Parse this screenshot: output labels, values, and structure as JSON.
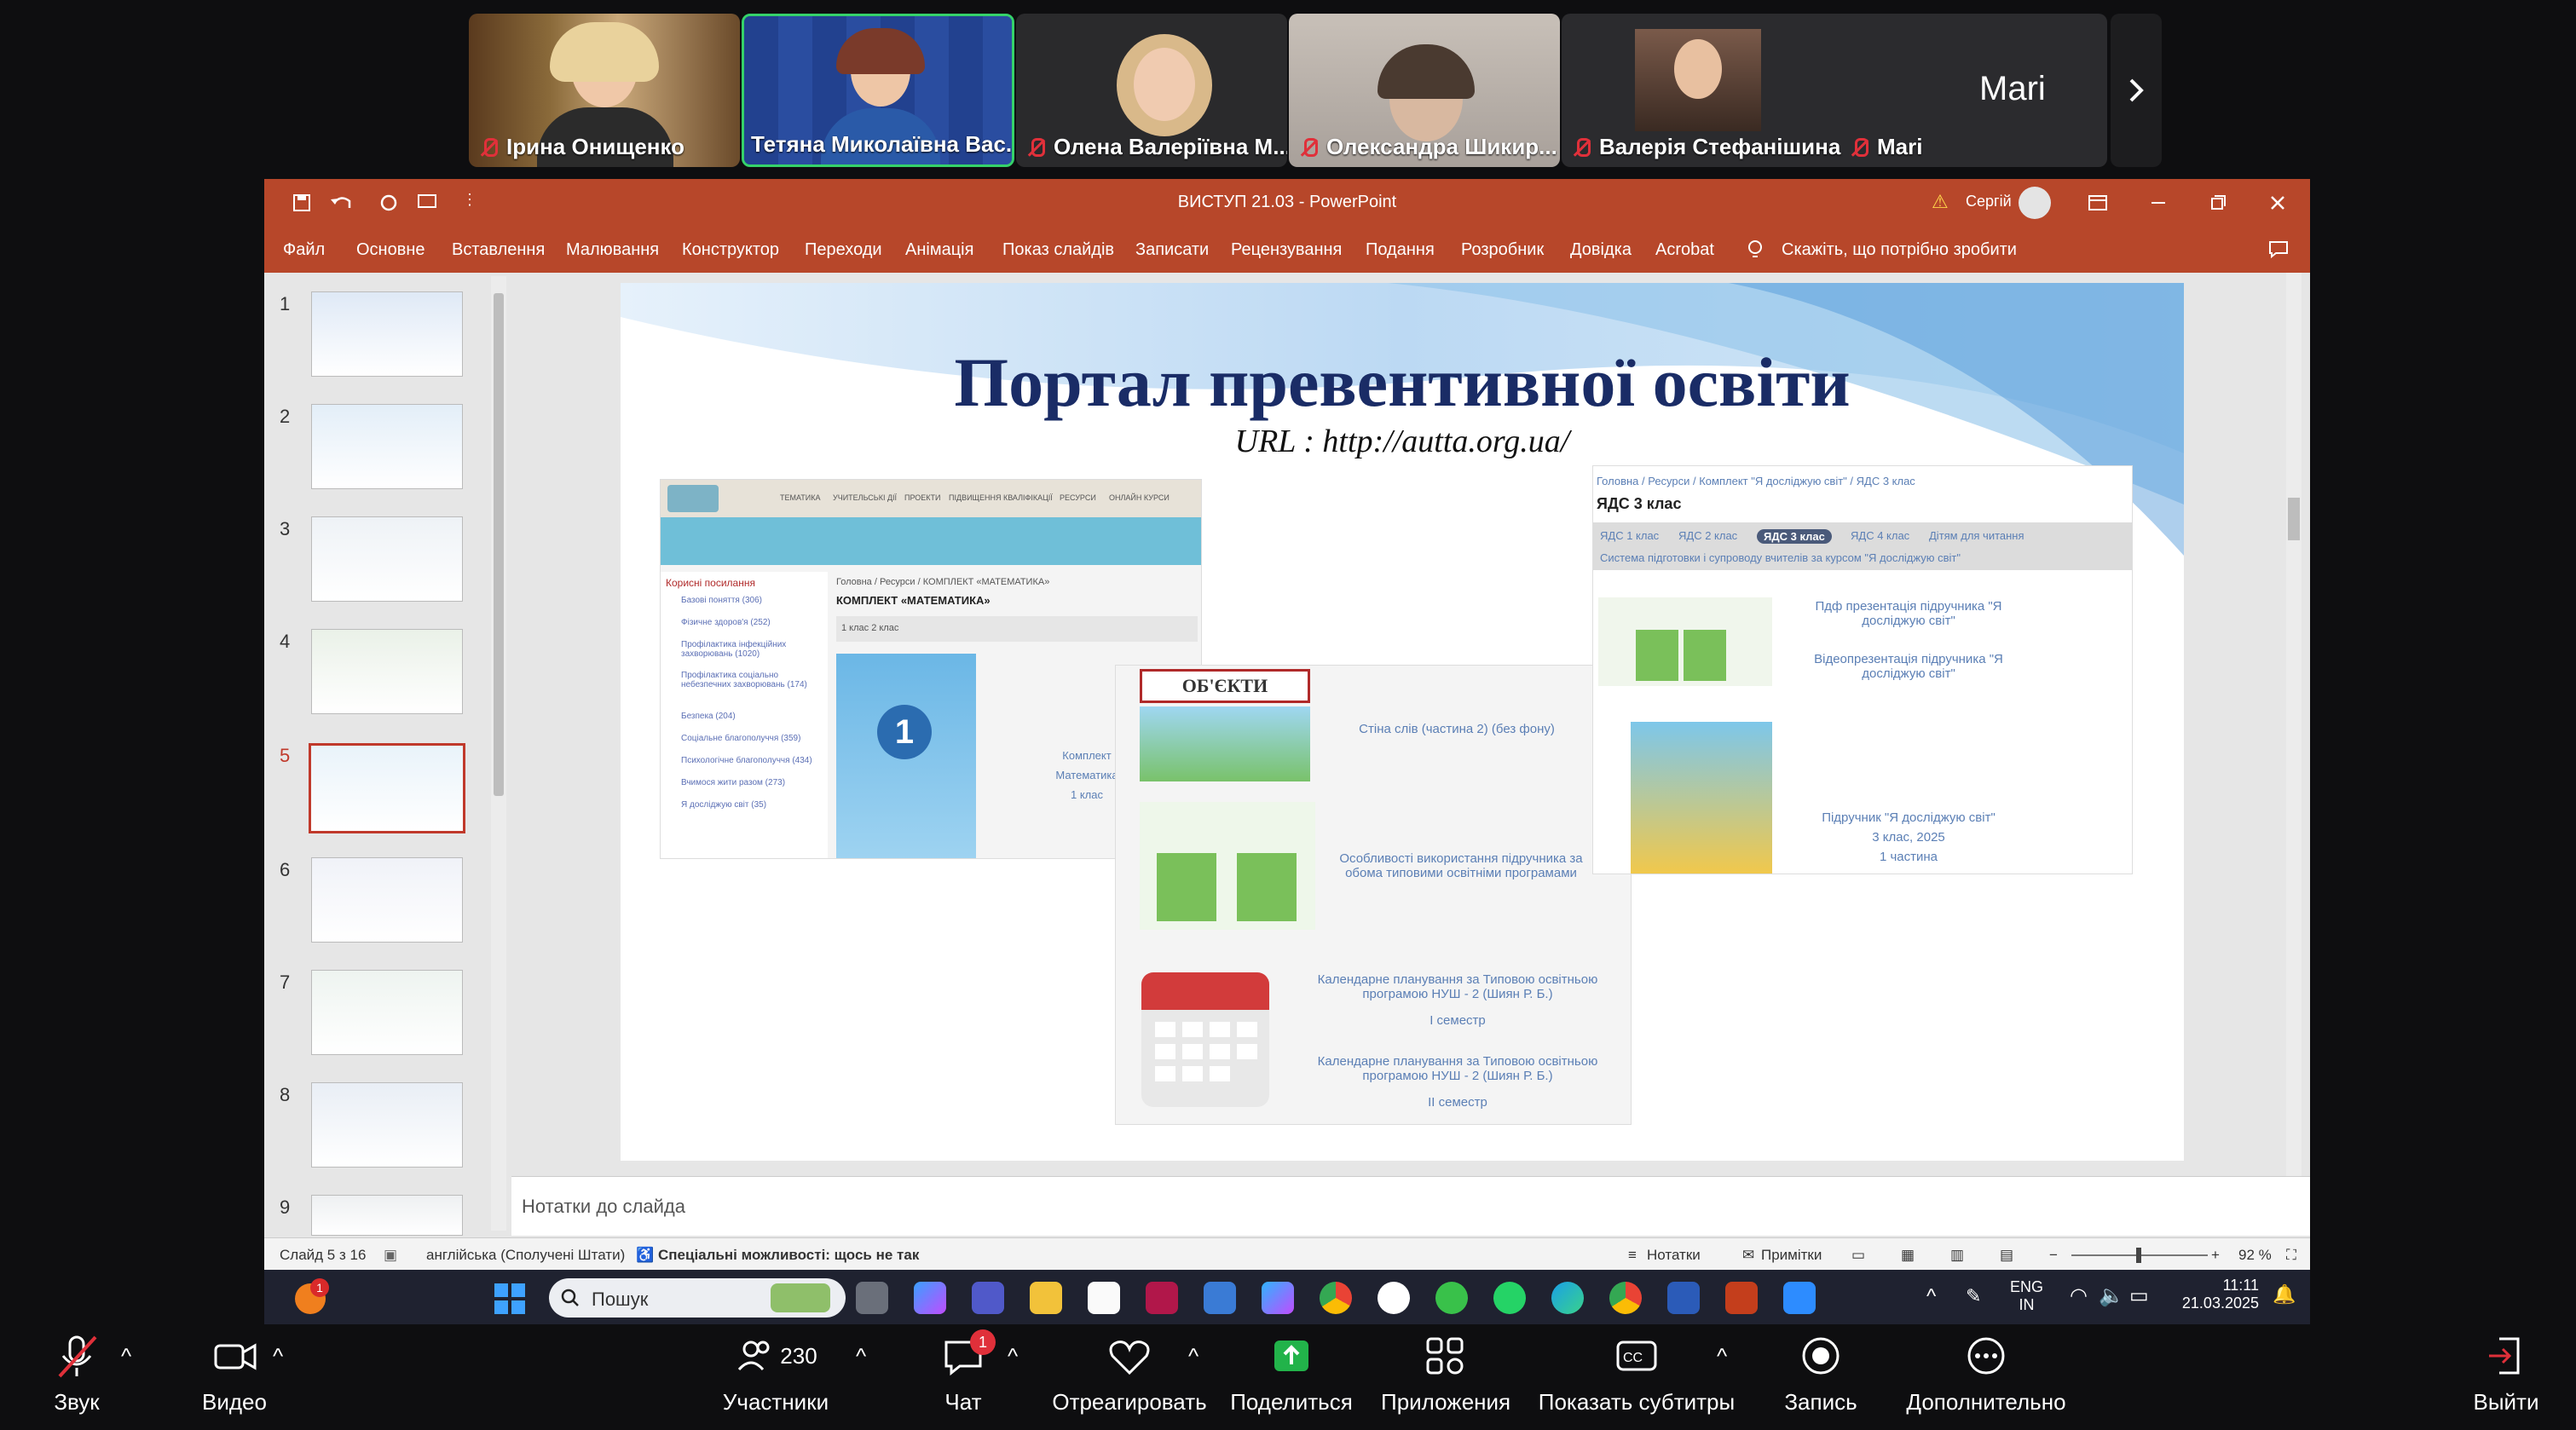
{
  "participants": [
    {
      "name": "Ірина Онищенко"
    },
    {
      "name": "Тетяна Миколаївна Вас..."
    },
    {
      "name": "Олена Валеріївна М..."
    },
    {
      "name": "Олександра Шикир..."
    },
    {
      "name": "Валерія Стефанішина"
    },
    {
      "name": "Mari",
      "big_label": "Mari"
    }
  ],
  "ppt": {
    "file_title": "ВИСТУП 21.03",
    "app": "PowerPoint",
    "title_sep": "-",
    "user": "Сергій",
    "tabs": [
      "Файл",
      "Основне",
      "Вставлення",
      "Малювання",
      "Конструктор",
      "Переходи",
      "Анімація",
      "Показ слайдів",
      "Записати",
      "Рецензування",
      "Подання",
      "Розробник",
      "Довідка",
      "Acrobat"
    ],
    "tell_me": "Скажіть, що потрібно зробити",
    "thumb_numbers": [
      "1",
      "2",
      "3",
      "4",
      "5",
      "6",
      "7",
      "8",
      "9"
    ],
    "notes_placeholder": "Нотатки до слайда",
    "status": {
      "slide": "Слайд 5 з 16",
      "language": "англійська (Сполучені Штати)",
      "accessibility": "Спеціальні можливості: щось не так",
      "notes": "Нотатки",
      "comments": "Примітки",
      "zoom": "92 %"
    }
  },
  "slide": {
    "title": "Портал превентивної освіти",
    "url": "URL : http://autta.org.ua/",
    "left_nav": [
      "ТЕМАТИКА",
      "УЧИТЕЛЬСЬКІ ДІЇ",
      "ПРОЕКТИ",
      "ПІДВИЩЕННЯ КВАЛІФІКАЦІЇ",
      "РЕСУРСИ",
      "ОНЛАЙН КУРСИ"
    ],
    "left_sidebar_title": "Корисні посилання",
    "left_sidebar_items": [
      "Базові поняття (306)",
      "Фізичне здоров'я (252)",
      "Профілактика інфекційних захворювань (1020)",
      "Профілактика соціально небезпечних захворювань (174)",
      "Безпека (204)",
      "Соціальне благополуччя (359)",
      "Психологічне благополуччя (434)",
      "Вчимося жити разом (273)",
      "Я досліджую світ (35)"
    ],
    "left_breadcrumb": "Головна / Ресурси / КОМПЛЕКТ «МАТЕМАТИКА»",
    "left_heading": "КОМПЛЕКТ «МАТЕМАТИКА»",
    "left_pills": "1 клас  2 клас",
    "math_caption": [
      "Комплект",
      "Математика",
      "1 клас"
    ],
    "objects_label": "ОБ'ЄКТИ",
    "obj_links": [
      "Стіна слів (частина 2) (без фону)",
      "Особливості використання підручника за обома типовими освітніми програмами",
      "Календарне планування за Типовою освітньою програмою НУШ - 2 (Шиян Р. Б.)",
      "І семестр",
      "Календарне планування за Типовою освітньою програмою НУШ - 2 (Шиян Р. Б.)",
      "ІІ семестр"
    ],
    "right_breadcrumb": "Головна / Ресурси / Комплект \"Я досліджую світ\" / ЯДС 3 клас",
    "right_heading": "ЯДС 3 клас",
    "right_tabs": [
      "ЯДС 1 клас",
      "ЯДС 2 клас",
      "ЯДС 3 клас",
      "ЯДС 4 клас",
      "Дітям для читання"
    ],
    "right_subtab": "Система підготовки і супроводу вчителів за курсом \"Я досліджую світ\"",
    "right_links": [
      "Пдф презентація підручника \"Я досліджую світ\"",
      "Відеопрезентація підручника \"Я досліджую світ\""
    ],
    "book_caption": [
      "Підручник \"Я досліджую світ\"",
      "3 клас, 2025",
      "1 частина"
    ]
  },
  "taskbar": {
    "search": "Пошук",
    "lang": [
      "ENG",
      "IN"
    ],
    "time": "11:11",
    "date": "21.03.2025",
    "badge": "1"
  },
  "controls": {
    "audio": "Звук",
    "video": "Видео",
    "participants": "Участники",
    "participants_count": "230",
    "chat": "Чат",
    "chat_badge": "1",
    "react": "Отреагировать",
    "share": "Поделиться",
    "apps": "Приложения",
    "captions": "Показать субтитры",
    "record": "Запись",
    "more": "Дополнительно",
    "leave": "Выйти"
  },
  "colors": {
    "ppt_brand": "#b7472a",
    "zoom_share_green": "#22b34a",
    "mic_off_red": "#e0303a"
  }
}
